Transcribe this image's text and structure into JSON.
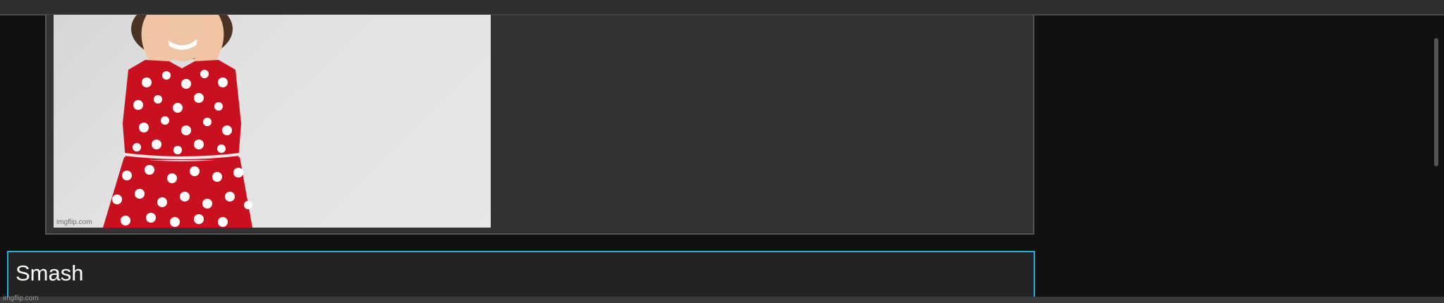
{
  "meme": {
    "image_alt": "Smiling girl in red polka dot dress with hands on cheeks",
    "watermark": "imgflip.com"
  },
  "caption": {
    "text": "Smash"
  },
  "footer": {
    "watermark": "imgflip.com"
  },
  "colors": {
    "caption_border": "#1fb1d8",
    "dress_red": "#c8101f",
    "background": "#111111"
  }
}
